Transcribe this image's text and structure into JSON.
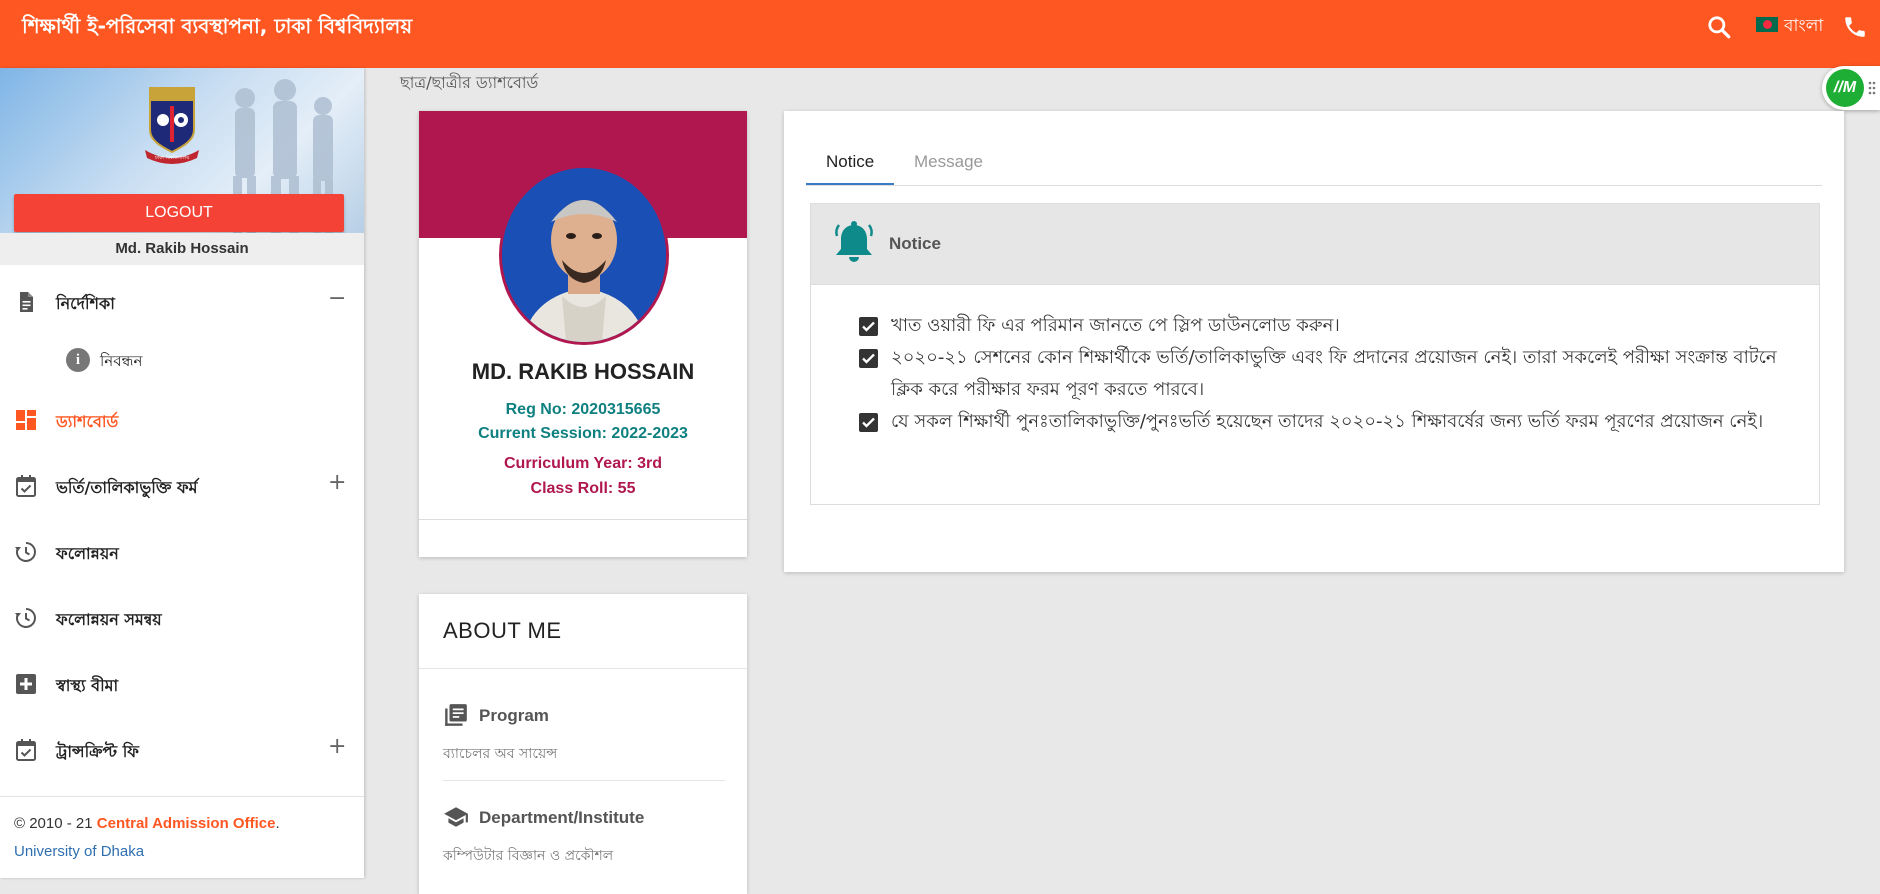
{
  "header": {
    "title": "শিক্ষার্থী ই-পরিসেবা ব্যবস্থাপনা, ঢাকা বিশ্ববিদ্যালয়",
    "language_label": "বাংলা"
  },
  "sidebar": {
    "logout_label": "LOGOUT",
    "user_name": "Md. Rakib Hossain",
    "logo_text": "ঢাকা বিশ্ববিদ্যালয়",
    "items": [
      {
        "label": "নির্দেশিকা",
        "icon": "document-icon",
        "toggle": "−"
      },
      {
        "label": "নিবন্ধন",
        "icon": "info-icon",
        "sub": true
      },
      {
        "label": "ড্যাশবোর্ড",
        "icon": "dashboard-icon",
        "active": true
      },
      {
        "label": "ভর্তি/তালিকাভুক্তি ফর্ম",
        "icon": "calendar-check-icon",
        "toggle": "+"
      },
      {
        "label": "ফলোন্নয়ন",
        "icon": "history-icon"
      },
      {
        "label": "ফলোন্নয়ন সমন্বয়",
        "icon": "history-icon"
      },
      {
        "label": "স্বাস্থ্য বীমা",
        "icon": "plus-box-icon"
      },
      {
        "label": "ট্রান্সক্রিপ্ট ফি",
        "icon": "calendar-check-icon",
        "toggle": "+"
      }
    ],
    "footer": {
      "copyright": "© 2010 - 21 ",
      "org": "Central Admission Office",
      "period": ".",
      "university": "University of Dhaka"
    }
  },
  "breadcrumb": "ছাত্র/ছাত্রীর ড্যাশবোর্ড",
  "profile": {
    "name": "MD. RAKIB HOSSAIN",
    "reg_no": "Reg No: 2020315665",
    "session": "Current Session: 2022-2023",
    "curriculum_year": "Curriculum Year: 3rd",
    "class_roll": "Class Roll: 55"
  },
  "about": {
    "title": "ABOUT ME",
    "program_label": "Program",
    "program_value": "ব্যাচেলর অব সায়েন্স",
    "department_label": "Department/Institute",
    "department_value": "কম্পিউটার বিজ্ঞান ও প্রকৌশল"
  },
  "notice_card": {
    "tabs": [
      "Notice",
      "Message"
    ],
    "panel_title": "Notice",
    "items": [
      "খাত ওয়ারী ফি এর পরিমান জানতে পে স্লিপ ডাউনলোড করুন।",
      "২০২০-২১ সেশনের কোন শিক্ষার্থীকে ভর্তি/তালিকাভুক্তি এবং ফি প্রদানের প্রয়োজন নেই। তারা সকলেই পরীক্ষা সংক্রান্ত বাটনে ক্লিক করে পরীক্ষার ফরম পূরণ করতে পারবে।",
      "যে সকল শিক্ষার্থী পুনঃতালিকাভুক্তি/পুনঃভর্তি হয়েছেন তাদের ২০২০-২১ শিক্ষাবর্ষের জন্য ভর্তি ফরম পূরণের প্রয়োজন নেই।"
    ]
  },
  "floating_badge": {
    "label": "//M"
  },
  "colors": {
    "topbar": "#ff5722",
    "profile_banner": "#b0174f",
    "teal_text": "#0f8080",
    "logout": "#f44336",
    "tab_underline": "#3a7bc8"
  }
}
